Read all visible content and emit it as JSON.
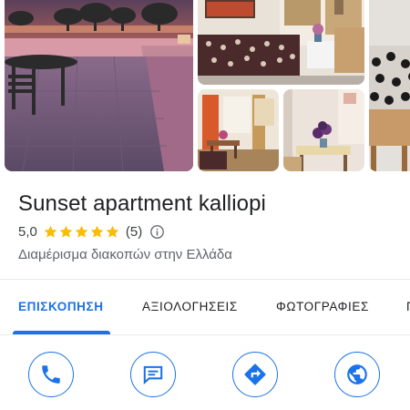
{
  "place": {
    "name": "Sunset apartment kalliopi",
    "rating_value": "5,0",
    "rating_stars": 5,
    "review_count": "(5)",
    "category": "Διαμέρισμα διακοπών στην Ελλάδα"
  },
  "tabs": [
    {
      "label": "ΕΠΙΣΚΟΠΗΣΗ",
      "active": true
    },
    {
      "label": "ΑΞΙΟΛΟΓΗΣΕΙΣ",
      "active": false
    },
    {
      "label": "ΦΩΤΟΓΡΑΦΙΕΣ",
      "active": false
    },
    {
      "label": "Π",
      "active": false
    }
  ],
  "actions": [
    {
      "icon": "phone-icon"
    },
    {
      "icon": "message-icon"
    },
    {
      "icon": "directions-icon"
    },
    {
      "icon": "website-globe-icon"
    }
  ],
  "photos": [
    {
      "subject": "sunset-terrace"
    },
    {
      "subject": "living-room"
    },
    {
      "subject": "armchair"
    },
    {
      "subject": "bedroom-room"
    },
    {
      "subject": "dining-table"
    }
  ],
  "colors": {
    "accent": "#1a73e8",
    "star": "#fbbc04",
    "text_primary": "#202124",
    "text_secondary": "#5f6368"
  }
}
